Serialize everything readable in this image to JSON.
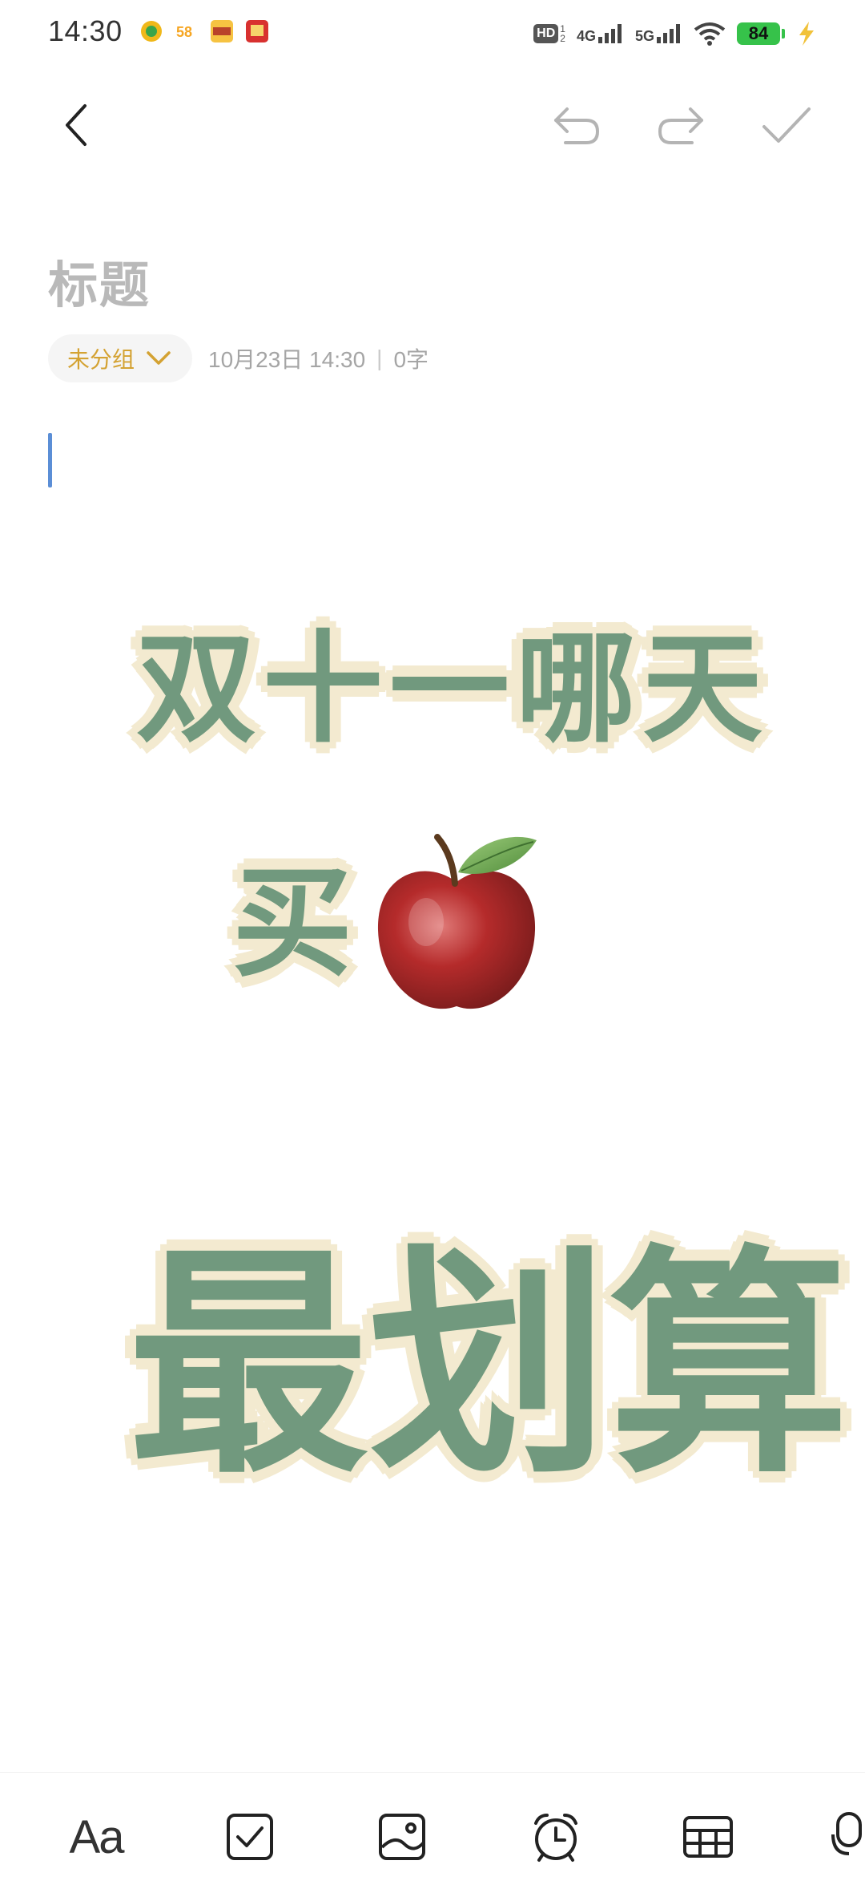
{
  "status_bar": {
    "time": "14:30",
    "apps": [
      {
        "icon": "lottery-app-icon",
        "color": "#f0b81a"
      },
      {
        "icon": "58-app-icon",
        "color": "#f6a623",
        "text": "58"
      },
      {
        "icon": "meituan-app-icon",
        "color": "#f6c342"
      },
      {
        "icon": "taobao-app-icon",
        "color": "#d8312f"
      }
    ],
    "network_hd": "HD",
    "network_4g": "4G",
    "network_5g": "5G",
    "battery": "84"
  },
  "toolbar": {
    "back_icon": "back-icon",
    "undo_icon": "undo-icon",
    "redo_icon": "redo-icon",
    "confirm_icon": "check-icon"
  },
  "note": {
    "title_placeholder": "标题",
    "group_label": "未分组",
    "date": "10月23日 14:30",
    "separator": "|",
    "word_count": "0字"
  },
  "poster": {
    "line1": "双十一哪天",
    "line2": "买",
    "line3": "最划算",
    "apple_icon": "apple-emoji-icon"
  },
  "bottom_bar": {
    "text_style_label": "Aa",
    "items": [
      "text-style-icon",
      "checklist-icon",
      "image-icon",
      "alarm-icon",
      "table-icon",
      "microphone-icon"
    ]
  },
  "colors": {
    "accent": "#d4a232",
    "sticker_green": "#71997e",
    "sticker_cream": "#f3ead0",
    "caret": "#5b8ed6"
  }
}
